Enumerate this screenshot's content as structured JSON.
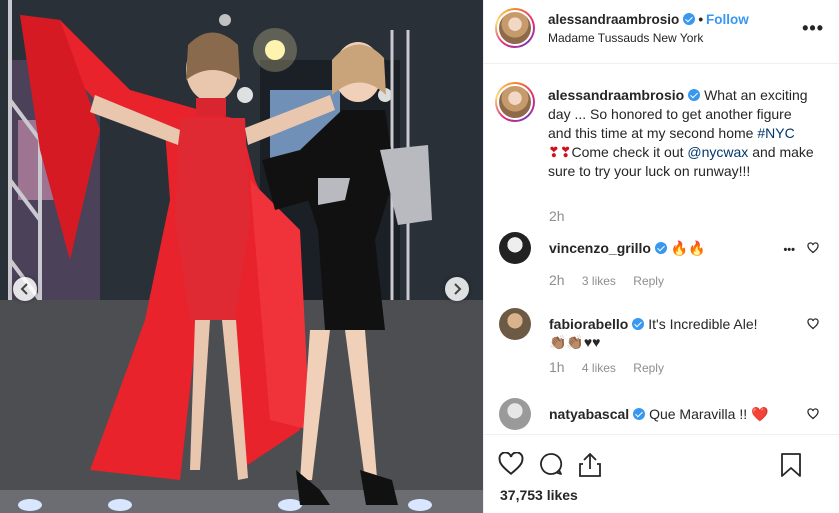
{
  "post": {
    "username": "alessandraambrosio",
    "follow_label": "Follow",
    "separator": "•",
    "location": "Madame Tussauds New York",
    "more": "•••"
  },
  "caption": {
    "username": "alessandraambrosio",
    "text_1": "What an exciting day ... So honored to get another figure and this time at my second home ",
    "hashtag": "#NYC",
    "hearts": "❣❣",
    "text_2": "Come check it out ",
    "mention": "@nycwax",
    "text_3": " and make sure to try your luck on runway!!!",
    "time": "2h"
  },
  "comments": [
    {
      "username": "vincenzo_grillo",
      "text": "🔥🔥",
      "time": "2h",
      "likes": "3 likes",
      "reply": "Reply",
      "more": "•••"
    },
    {
      "username": "fabiorabello",
      "text": "It's Incredible Ale! 👏🏽👏🏽♥♥",
      "time": "1h",
      "likes": "4 likes",
      "reply": "Reply"
    },
    {
      "username": "natyabascal",
      "text": "Que Maravilla !! ❤️"
    }
  ],
  "likes_count": "37,753 likes",
  "icons": {
    "photo_prev": "chevron-left-icon",
    "photo_next": "chevron-right-icon",
    "like": "heart-icon",
    "comment": "comment-icon",
    "share": "share-icon",
    "save": "bookmark-icon"
  },
  "colors": {
    "link_blue": "#3897f0",
    "verified_blue": "#3897f0",
    "muted_text": "#8e8e8e",
    "dress_red": "#e8232c"
  }
}
